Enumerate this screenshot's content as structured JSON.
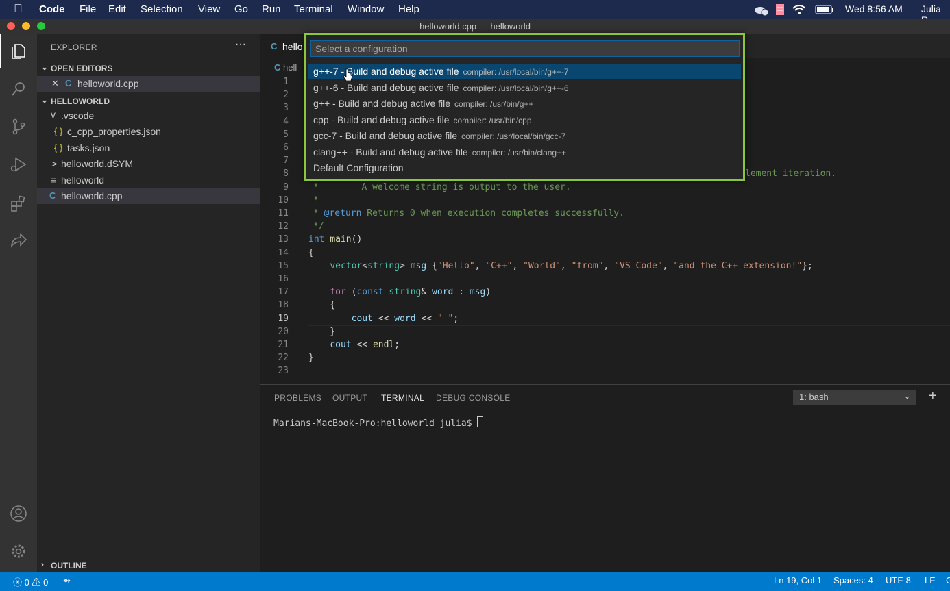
{
  "menubar": {
    "app": "Code",
    "items": [
      "File",
      "Edit",
      "Selection",
      "View",
      "Go",
      "Run",
      "Terminal",
      "Window",
      "Help"
    ],
    "clock": "Wed 8:56 AM",
    "user": "Julia R"
  },
  "window": {
    "title": "helloworld.cpp — helloworld"
  },
  "activity": [
    "explorer-icon",
    "search-icon",
    "source-control-icon",
    "run-debug-icon",
    "extensions-icon",
    "live-share-icon",
    "account-icon",
    "settings-gear-icon"
  ],
  "explorer": {
    "title": "EXPLORER",
    "open_editors": {
      "title": "OPEN EDITORS",
      "items": [
        {
          "close": "✕",
          "icon": "C",
          "name": "helloworld.cpp"
        }
      ]
    },
    "folder": {
      "title": "HELLOWORLD",
      "tree": [
        {
          "name": ".vscode",
          "icon": "v"
        },
        {
          "name": "c_cpp_properties.json",
          "icon": "{ }"
        },
        {
          "name": "tasks.json",
          "icon": "{ }"
        },
        {
          "name": "helloworld.dSYM",
          "icon": ">"
        },
        {
          "name": "helloworld",
          "icon": "≡"
        },
        {
          "name": "helloworld.cpp",
          "icon": "C"
        }
      ]
    },
    "outline": "OUTLINE"
  },
  "editor": {
    "tab_label": "hello",
    "breadcrumb": "hell",
    "line_numbers": [
      "1",
      "2",
      "3",
      "4",
      "5",
      "6",
      "7",
      "8",
      "9",
      "10",
      "11",
      "12",
      "13",
      "14",
      "15",
      "16",
      "17",
      "18",
      "19",
      "20",
      "21",
      "22",
      "23"
    ],
    "lines": [
      {
        "n": 8,
        "html": "<span class=\"cm\">lement iteration.</span>"
      },
      {
        "n": 9,
        "html": "<span class=\"cm\">*        A welcome string is output to the user.</span>"
      },
      {
        "n": 10,
        "html": "<span class=\"cm\">*</span>"
      },
      {
        "n": 11,
        "html": "<span class=\"cm\">* <span class=\"kw\">@return</span> Returns 0 when execution completes successfully.</span>"
      },
      {
        "n": 12,
        "html": "<span class=\"cm\">*/</span>"
      },
      {
        "n": 13,
        "html": "<span class=\"kw\">int</span> <span class=\"fn\">main</span>()"
      },
      {
        "n": 14,
        "html": "{"
      },
      {
        "n": 15,
        "html": "    <span class=\"ty\">vector</span>&lt;<span class=\"ty\">string</span>&gt; <span class=\"var\">msg</span> {<span class=\"str\">\"Hello\"</span>, <span class=\"str\">\"C++\"</span>, <span class=\"str\">\"World\"</span>, <span class=\"str\">\"from\"</span>, <span class=\"str\">\"VS Code\"</span>, <span class=\"str\">\"and the C++ extension!\"</span>};"
      },
      {
        "n": 16,
        "html": ""
      },
      {
        "n": 17,
        "html": "    <span class=\"ctl\">for</span> (<span class=\"kw\">const</span> <span class=\"ty\">string</span>&amp; <span class=\"var\">word</span> : <span class=\"var\">msg</span>)"
      },
      {
        "n": 18,
        "html": "    {"
      },
      {
        "n": 19,
        "html": "        <span class=\"var\">cout</span> &lt;&lt; <span class=\"var\">word</span> &lt;&lt; <span class=\"str\">\" \"</span>;"
      },
      {
        "n": 20,
        "html": "    }"
      },
      {
        "n": 21,
        "html": "    <span class=\"var\">cout</span> &lt;&lt; <span class=\"fn\">endl</span>;"
      },
      {
        "n": 22,
        "html": "}"
      },
      {
        "n": 23,
        "html": ""
      }
    ]
  },
  "quick_pick": {
    "placeholder": "Select a configuration",
    "items": [
      {
        "label": "g++-7 - Build and debug active file",
        "description": "compiler: /usr/local/bin/g++-7",
        "selected": true
      },
      {
        "label": "g++-6 - Build and debug active file",
        "description": "compiler: /usr/local/bin/g++-6"
      },
      {
        "label": "g++ - Build and debug active file",
        "description": "compiler: /usr/bin/g++"
      },
      {
        "label": "cpp - Build and debug active file",
        "description": "compiler: /usr/bin/cpp"
      },
      {
        "label": "gcc-7 - Build and debug active file",
        "description": "compiler: /usr/local/bin/gcc-7"
      },
      {
        "label": "clang++ - Build and debug active file",
        "description": "compiler: /usr/bin/clang++"
      },
      {
        "label": "Default Configuration",
        "description": ""
      }
    ]
  },
  "panel": {
    "tabs": [
      "PROBLEMS",
      "OUTPUT",
      "TERMINAL",
      "DEBUG CONSOLE"
    ],
    "active_tab": "TERMINAL",
    "terminal_select": "1: bash",
    "add": "+",
    "prompt": "Marians-MacBook-Pro:helloworld julia$ "
  },
  "status": {
    "errors": "0",
    "warnings": "0",
    "position": "Ln 19, Col 1",
    "spaces": "Spaces: 4",
    "encoding": "UTF-8",
    "eol": "LF",
    "language": "C"
  },
  "colors": {
    "accent": "#007acc",
    "highlight_border": "#8cc63f",
    "selection": "#094771"
  }
}
